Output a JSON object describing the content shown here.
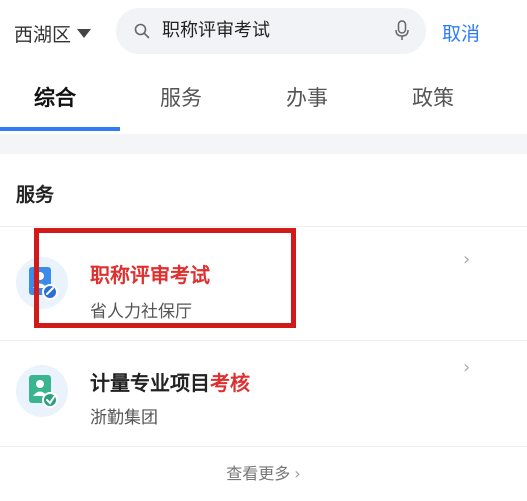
{
  "header": {
    "district": "西湖区",
    "search_query": "职称评审考试",
    "cancel_label": "取消"
  },
  "tabs": [
    {
      "label": "综合",
      "active": true
    },
    {
      "label": "服务",
      "active": false
    },
    {
      "label": "办事",
      "active": false
    },
    {
      "label": "政策",
      "active": false
    }
  ],
  "section": {
    "title": "服务",
    "items": [
      {
        "title_highlight": "职称评审考试",
        "title_plain": "",
        "subtitle": "省人力社保厅",
        "icon": "id-card-icon"
      },
      {
        "title_plain": "计量专业项目",
        "title_highlight": "考核",
        "subtitle": "浙勤集团",
        "icon": "person-card-icon"
      }
    ],
    "more_label": "查看更多"
  },
  "colors": {
    "accent": "#2f7cf6",
    "highlight": "#e02f2f",
    "annotation_box": "#d11a1a"
  }
}
